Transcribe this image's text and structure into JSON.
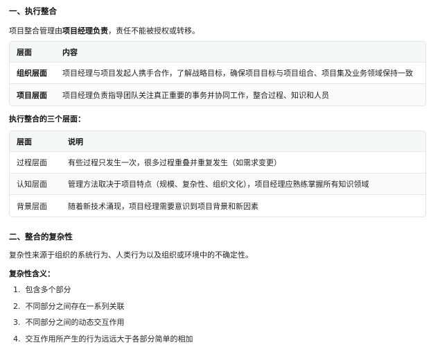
{
  "section1": {
    "title": "一、执行整合",
    "intro_before": "项目整合管理由",
    "intro_bold": "项目经理负责",
    "intro_after": "，责任不能被授权或转移。",
    "table1": {
      "headers": [
        "层面",
        "内容"
      ],
      "rows": [
        [
          "组织层面",
          "项目经理与项目发起人携手合作，了解战略目标，确保项目目标与项目组合、项目集及业务领域保持一致"
        ],
        [
          "项目层面",
          "项目经理负责指导团队关注真正重要的事务并协同工作，整合过程、知识和人员"
        ]
      ]
    },
    "subheading": "执行整合的三个层面：",
    "table2": {
      "headers": [
        "层面",
        "说明"
      ],
      "rows": [
        [
          "过程层面",
          "有些过程只发生一次，很多过程重叠并重复发生（如需求变更）"
        ],
        [
          "认知层面",
          "管理方法取决于项目特点（规模、复杂性、组织文化），项目经理应熟练掌握所有知识领域"
        ],
        [
          "背景层面",
          "随着新技术涌现，项目经理需要意识到项目背景和新因素"
        ]
      ]
    }
  },
  "section2": {
    "title": "二、整合的复杂性",
    "intro": "复杂性来源于组织的系统行为、人类行为以及组织或环境中的不确定性。",
    "subheading": "复杂性含义：",
    "items": [
      "包含多个部分",
      "不同部分之间存在一系列关联",
      "不同部分之间的动态交互作用",
      "交互作用所产生的行为远远大于各部分简单的相加"
    ]
  }
}
